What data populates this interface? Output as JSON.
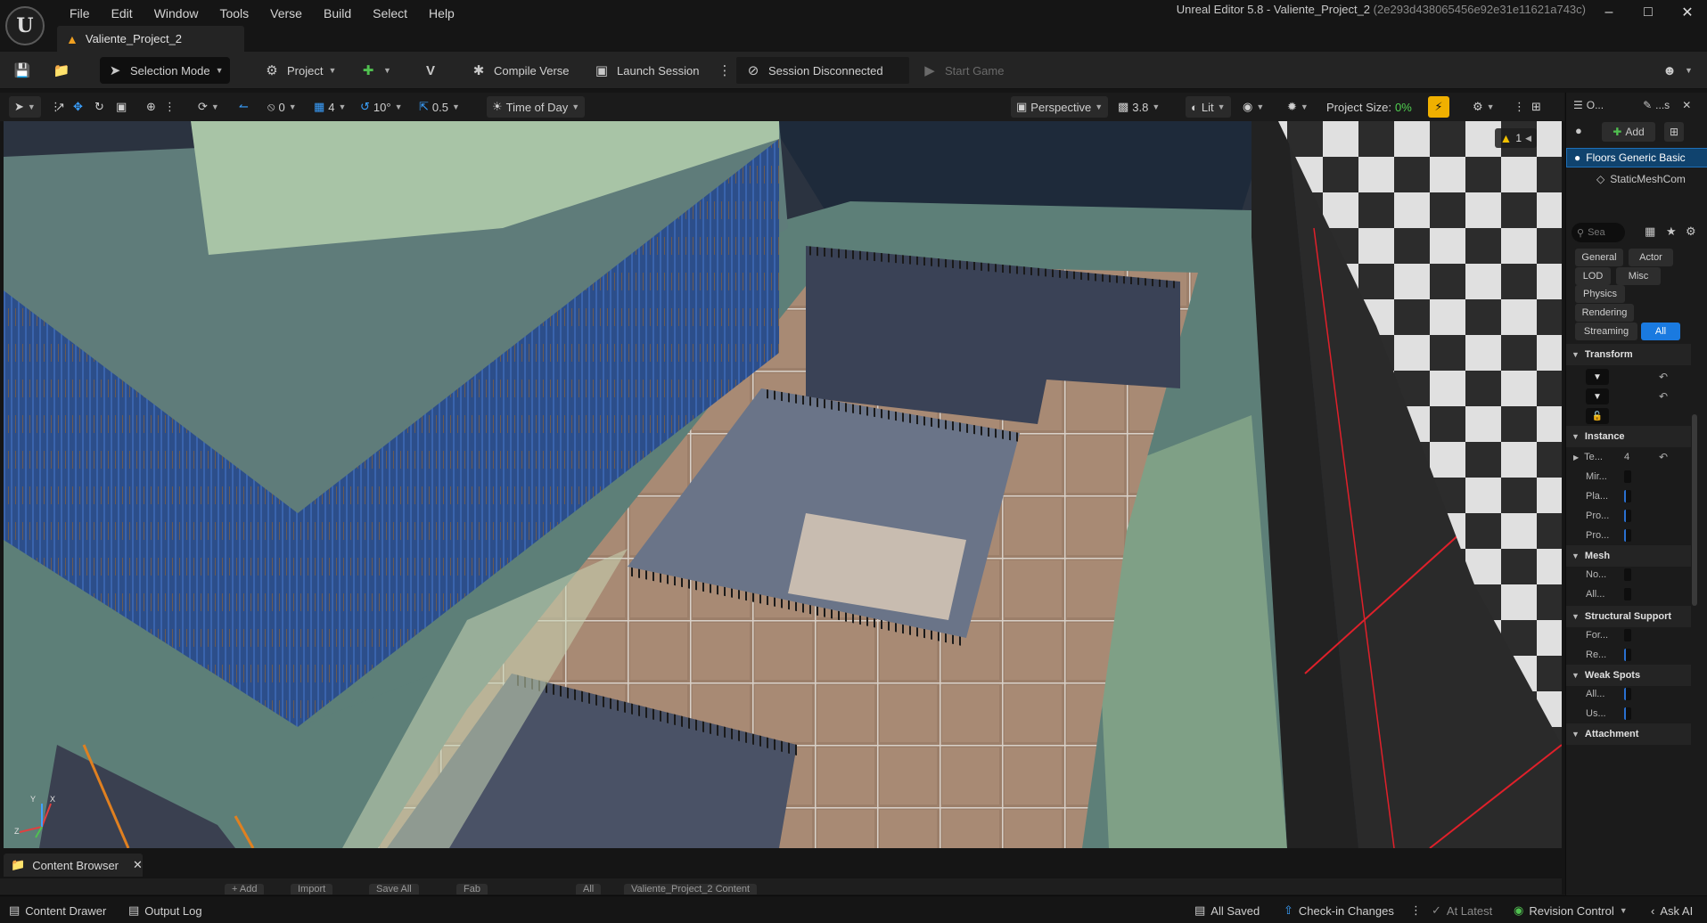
{
  "menu": [
    "File",
    "Edit",
    "Window",
    "Tools",
    "Verse",
    "Build",
    "Select",
    "Help"
  ],
  "window": {
    "title": "Unreal Editor 5.8 - Valiente_Project_2",
    "hash": "(2e293d438065456e92e31e11621a743c)"
  },
  "project_tab": "Valiente_Project_2",
  "toolbar": {
    "selection_mode": "Selection Mode",
    "project": "Project",
    "compile_verse": "Compile Verse",
    "launch_session": "Launch Session",
    "session_status": "Session Disconnected",
    "start_game": "Start Game"
  },
  "viewport_toolbar": {
    "rotation_snap": "0",
    "grid": "4",
    "angle": "10°",
    "scale": "0.5",
    "time_of_day": "Time of Day",
    "perspective": "Perspective",
    "camera_speed": "3.8",
    "lit": "Lit",
    "project_size_label": "Project Size:",
    "project_size_value": "0%"
  },
  "viewport": {
    "warning_count": "1",
    "axis_labels": [
      "X",
      "Y",
      "Z"
    ]
  },
  "outliner": {
    "tab1": "O...",
    "tab2": "...s",
    "add_label": "Add",
    "selected_item": "Floors Generic Basic",
    "child_item": "StaticMeshCom"
  },
  "details": {
    "search_placeholder": "Sea",
    "categories": [
      "General",
      "Actor",
      "LOD",
      "Misc",
      "Physics",
      "Rendering",
      "Streaming",
      "All"
    ],
    "sections": {
      "transform": "Transform",
      "instance": "Instance",
      "mesh": "Mesh",
      "structural": "Structural Support",
      "weak": "Weak Spots",
      "attachment": "Attachment"
    },
    "instance_props": [
      "Te...",
      "Mir...",
      "Pla...",
      "Pro...",
      "Pro..."
    ],
    "instance_first_value": "4",
    "mesh_props": [
      "No...",
      "All..."
    ],
    "structural_props": [
      "For...",
      "Re..."
    ],
    "weak_props": [
      "All...",
      "Us..."
    ]
  },
  "content_browser": {
    "tab": "Content Browser",
    "ghost": [
      "+ Add",
      "Import",
      "Save All",
      "Fab",
      "All",
      "Valiente_Project_2 Content"
    ]
  },
  "statusbar": {
    "content_drawer": "Content Drawer",
    "output_log": "Output Log",
    "all_saved": "All Saved",
    "check_in": "Check-in Changes",
    "at_latest": "At Latest",
    "revision_control": "Revision Control",
    "ask_ai": "Ask AI"
  }
}
